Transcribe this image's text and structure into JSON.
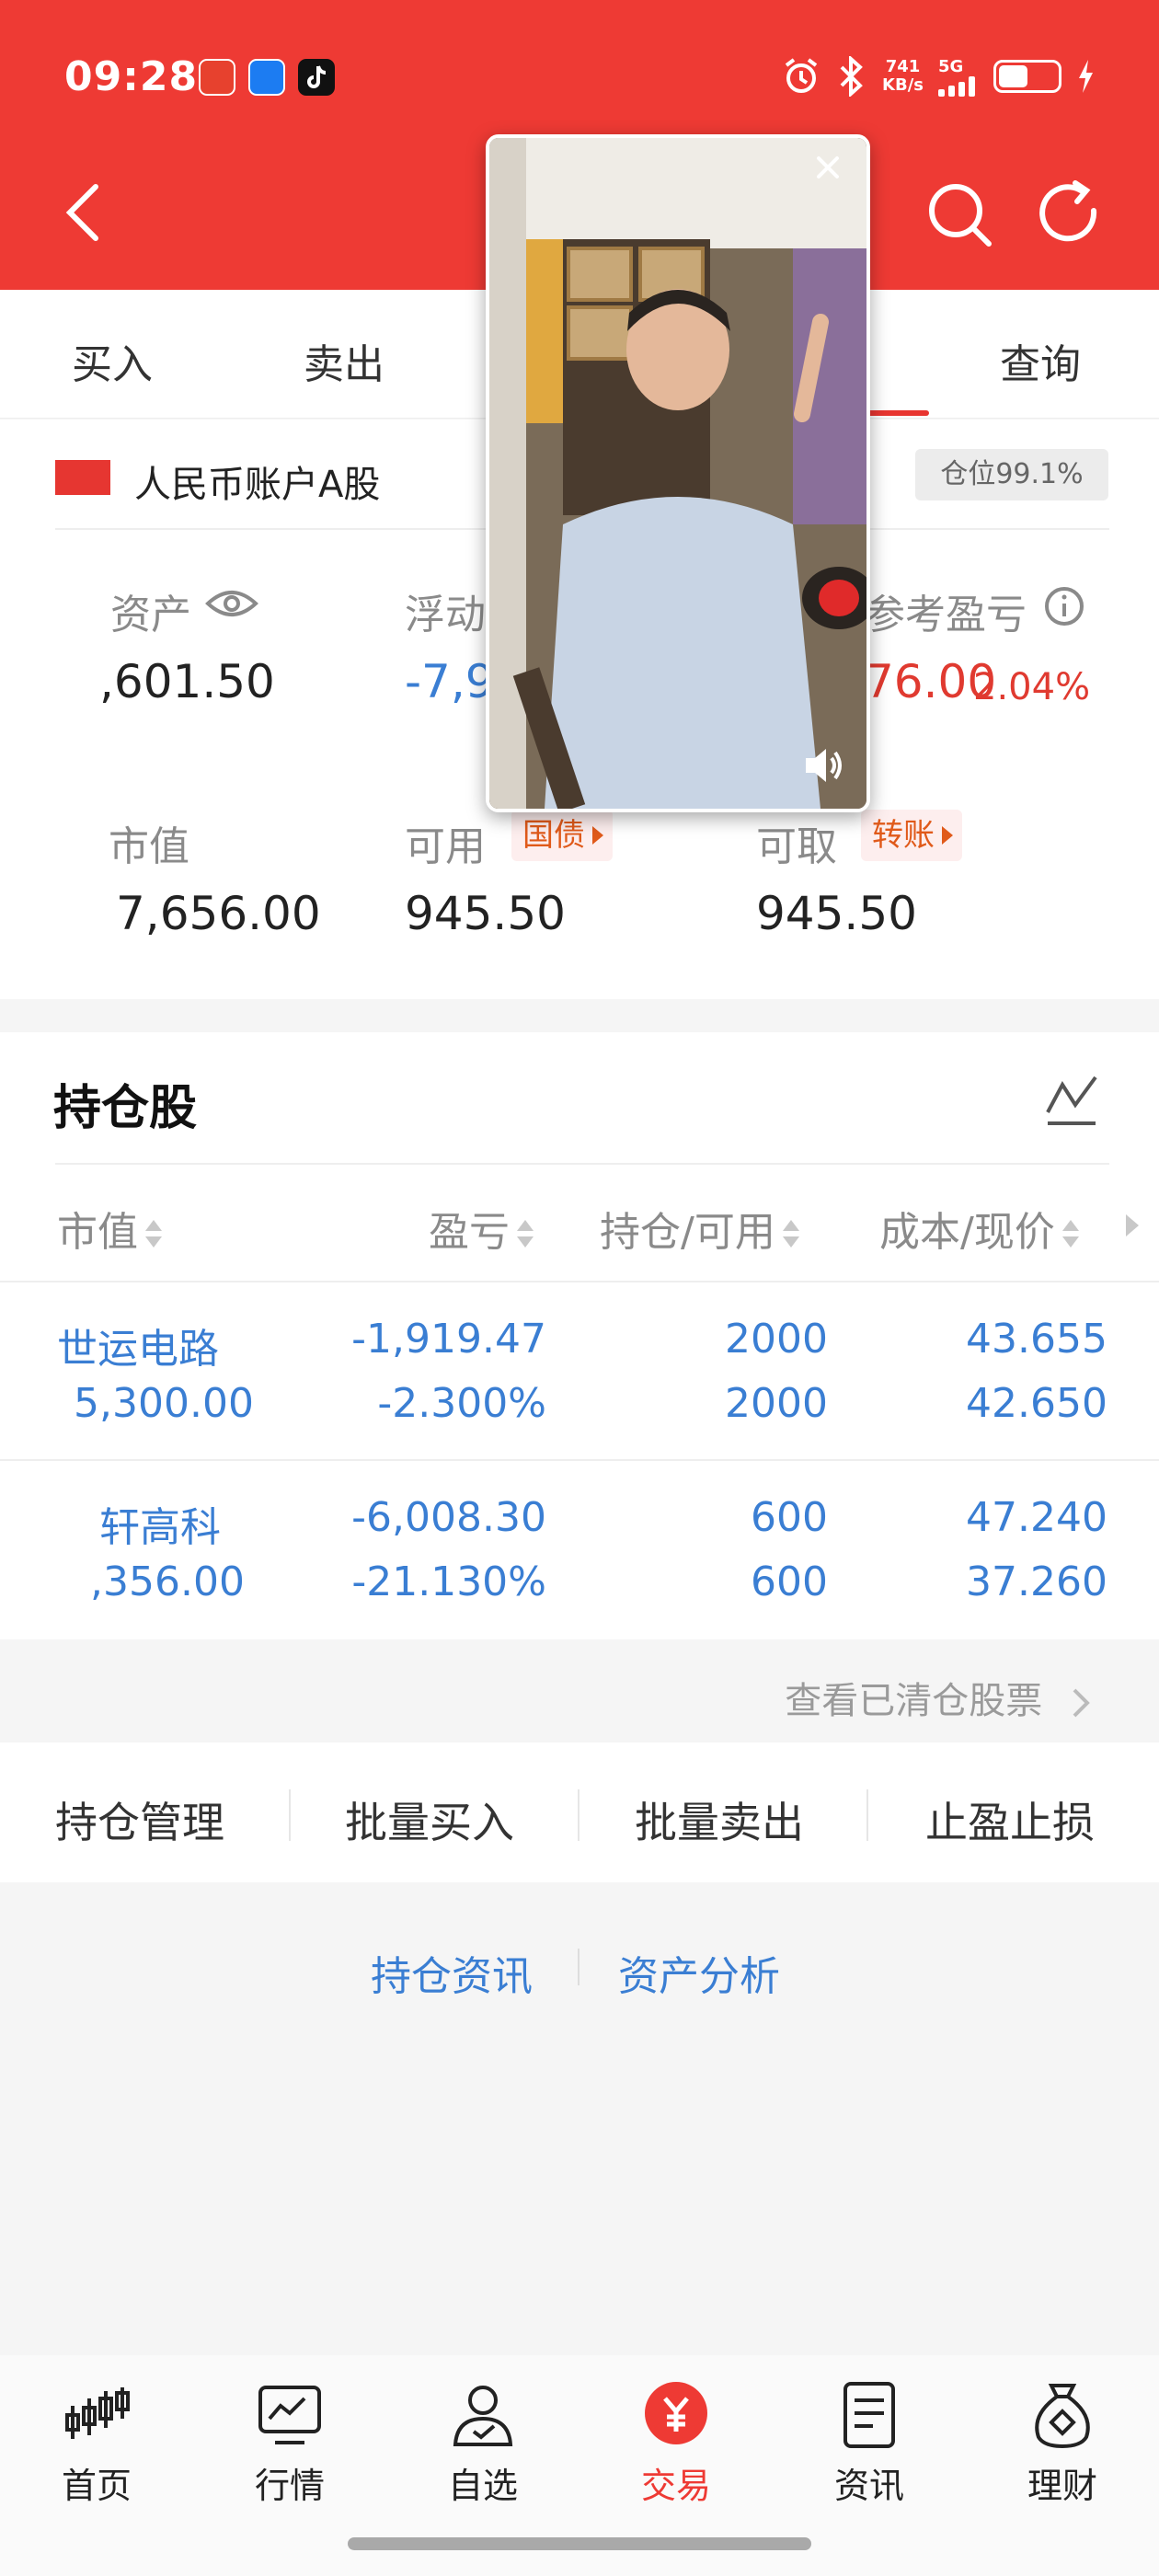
{
  "status_bar": {
    "time": "09:28",
    "net_speed_value": "741",
    "net_speed_unit": "KB/s",
    "net_type": "5G",
    "battery_level": 0.5
  },
  "header": {
    "back_icon": "back-chevron-icon",
    "search_icon": "search-icon",
    "refresh_icon": "refresh-icon"
  },
  "tabs": [
    {
      "label": "买入"
    },
    {
      "label": "卖出"
    },
    {
      "label": "查询"
    }
  ],
  "account": {
    "name": "人民币账户A股",
    "position_badge": "仓位99.1%",
    "total_assets_label": "资产",
    "total_assets_value": ",601.50",
    "floating_label": "浮动",
    "floating_value": "-7,9",
    "ref_pnl_label": "参考盈亏",
    "ref_pnl_value": "76.00",
    "ref_pnl_pct": "2.04%",
    "market_value_label": "市值",
    "market_value_value": "7,656.00",
    "available_label": "可用",
    "available_tag": "国债",
    "available_value": "945.50",
    "withdrawable_label": "可取",
    "withdrawable_tag": "转账",
    "withdrawable_value": "945.50"
  },
  "holdings": {
    "title": "持仓股",
    "columns": [
      "市值",
      "盈亏",
      "持仓/可用",
      "成本/现价"
    ],
    "rows": [
      {
        "name": "世运电路",
        "market_value": "5,300.00",
        "pnl": "-1,919.47",
        "pnl_pct": "-2.300%",
        "position": "2000",
        "available": "2000",
        "cost": "43.655",
        "price": "42.650"
      },
      {
        "name": "轩高科",
        "market_value": ",356.00",
        "pnl": "-6,008.30",
        "pnl_pct": "-21.130%",
        "position": "600",
        "available": "600",
        "cost": "47.240",
        "price": "37.260"
      }
    ],
    "cleared_link": "查看已清仓股票"
  },
  "actions": [
    "持仓管理",
    "批量买入",
    "批量卖出",
    "止盈止损"
  ],
  "links": [
    "持仓资讯",
    "资产分析"
  ],
  "bottom_nav": [
    {
      "label": "首页",
      "icon": "candlestick-icon",
      "active": false
    },
    {
      "label": "行情",
      "icon": "market-chart-icon",
      "active": false
    },
    {
      "label": "自选",
      "icon": "person-check-icon",
      "active": false
    },
    {
      "label": "交易",
      "icon": "yuan-coin-icon",
      "active": true
    },
    {
      "label": "资讯",
      "icon": "document-icon",
      "active": false
    },
    {
      "label": "理财",
      "icon": "money-bag-icon",
      "active": false
    }
  ],
  "colors": {
    "brand_red": "#ee3a34",
    "loss_blue": "#3a7ed3",
    "gain_red": "#e03a30",
    "tag_orange": "#e05a1a"
  }
}
